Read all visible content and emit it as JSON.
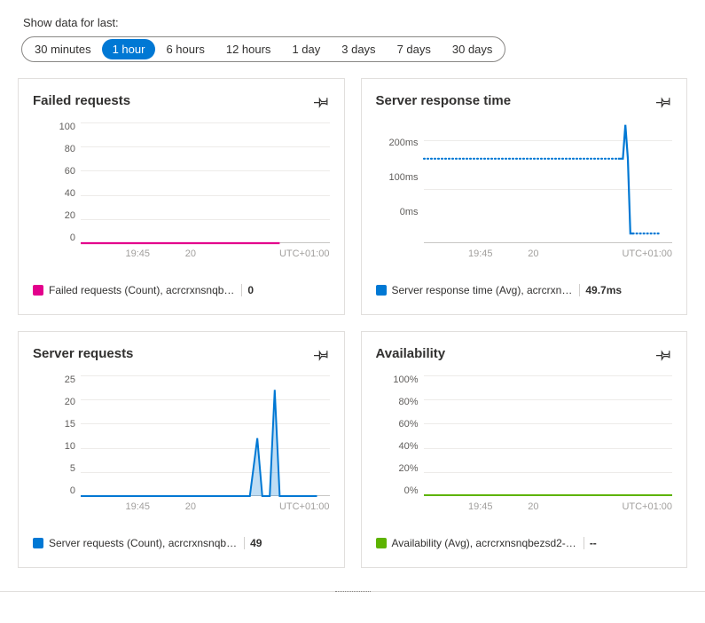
{
  "filter": {
    "label": "Show data for last:",
    "options": [
      "30 minutes",
      "1 hour",
      "6 hours",
      "12 hours",
      "1 day",
      "3 days",
      "7 days",
      "30 days"
    ],
    "selected_index": 1
  },
  "timezone_label": "UTC+01:00",
  "cards": [
    {
      "title": "Failed requests",
      "legend": "Failed requests (Count), acrcrxnsnqb…",
      "legend_value": "0",
      "swatch": "#e3008c"
    },
    {
      "title": "Server response time",
      "legend": "Server response time (Avg), acrcrxn…",
      "legend_value": "49.7ms",
      "swatch": "#0078d4"
    },
    {
      "title": "Server requests",
      "legend": "Server requests (Count), acrcrxnsnqb…",
      "legend_value": "49",
      "swatch": "#0078d4"
    },
    {
      "title": "Availability",
      "legend": "Availability (Avg), acrcrxnsnqbezsd2-…",
      "legend_value": "--",
      "swatch": "#5db300"
    }
  ],
  "chart_data": [
    {
      "type": "line",
      "title": "Failed requests",
      "x_ticks": [
        "19:45",
        "20"
      ],
      "ylabel": "",
      "ylim": [
        0,
        100
      ],
      "y_ticks": [
        0,
        20,
        40,
        60,
        80,
        100
      ],
      "series": [
        {
          "name": "Failed requests (Count)",
          "color": "#e3008c",
          "values_constant": 0
        }
      ],
      "timezone": "UTC+01:00"
    },
    {
      "type": "line",
      "title": "Server response time",
      "x_ticks": [
        "19:45",
        "20"
      ],
      "ylabel": "",
      "ylim": [
        0,
        220
      ],
      "y_ticks_labels": [
        "0ms",
        "100ms",
        "200ms"
      ],
      "y_ticks_values": [
        0,
        100,
        200
      ],
      "series": [
        {
          "name": "Server response time (Avg)",
          "color": "#0078d4",
          "segments": [
            {
              "style": "dotted",
              "from_x_frac": 0.0,
              "to_x_frac": 0.78,
              "value": 170
            },
            {
              "style": "solid_spike",
              "x_frac": 0.8,
              "peak": 220,
              "base": 170
            },
            {
              "style": "drop",
              "x_frac": 0.82,
              "to_value": 15
            },
            {
              "style": "dotted",
              "from_x_frac": 0.84,
              "to_x_frac": 0.95,
              "value": 15
            }
          ],
          "summary_value_ms": 49.7
        }
      ],
      "timezone": "UTC+01:00"
    },
    {
      "type": "area",
      "title": "Server requests",
      "x_ticks": [
        "19:45",
        "20"
      ],
      "ylabel": "",
      "ylim": [
        0,
        25
      ],
      "y_ticks": [
        0,
        5,
        10,
        15,
        20,
        25
      ],
      "series": [
        {
          "name": "Server requests (Count)",
          "color": "#0078d4",
          "values": [
            0,
            0,
            0,
            0,
            0,
            0,
            0,
            0,
            0,
            0,
            0,
            0,
            0,
            0,
            0,
            0,
            0,
            0,
            0,
            0,
            0,
            12,
            0,
            22,
            0,
            0
          ],
          "sum": 49
        }
      ],
      "timezone": "UTC+01:00"
    },
    {
      "type": "line",
      "title": "Availability",
      "x_ticks": [
        "19:45",
        "20"
      ],
      "ylabel": "",
      "ylim": [
        0,
        100
      ],
      "y_ticks_labels": [
        "0%",
        "20%",
        "40%",
        "60%",
        "80%",
        "100%"
      ],
      "y_ticks_values": [
        0,
        20,
        40,
        60,
        80,
        100
      ],
      "series": [
        {
          "name": "Availability (Avg)",
          "color": "#5db300",
          "values": null
        }
      ],
      "timezone": "UTC+01:00"
    }
  ]
}
